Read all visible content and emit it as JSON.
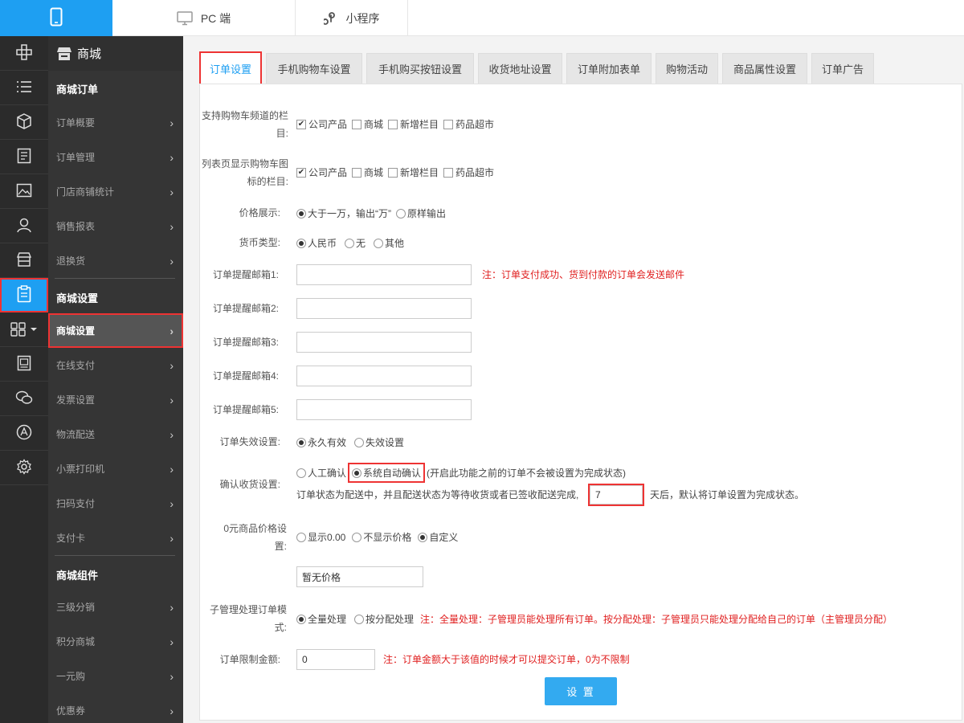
{
  "topbar": {
    "tabs": [
      {
        "label": "PC 端",
        "icon": "monitor-icon"
      },
      {
        "label": "小程序",
        "icon": "mini-program-icon"
      }
    ]
  },
  "sidebar": {
    "title": "商城",
    "sections": [
      {
        "title": "商城订单",
        "items": [
          "订单概要",
          "订单管理",
          "门店商铺统计",
          "销售报表",
          "退换货"
        ]
      },
      {
        "title": "商城设置",
        "items": [
          "商城设置",
          "在线支付",
          "发票设置",
          "物流配送",
          "小票打印机",
          "扫码支付",
          "支付卡"
        ]
      },
      {
        "title": "商城组件",
        "items": [
          "三级分销",
          "积分商城",
          "一元购",
          "优惠券"
        ]
      }
    ],
    "active_item": "商城设置"
  },
  "tabs": [
    "订单设置",
    "手机购物车设置",
    "手机购买按钮设置",
    "收货地址设置",
    "订单附加表单",
    "购物活动",
    "商品属性设置",
    "订单广告"
  ],
  "form": {
    "cart_channel": {
      "label": "支持购物车频道的栏目:",
      "options": [
        {
          "label": "公司产品",
          "checked": true
        },
        {
          "label": "商城",
          "checked": false
        },
        {
          "label": "新增栏目",
          "checked": false
        },
        {
          "label": "药品超市",
          "checked": false
        }
      ]
    },
    "list_cart_icon": {
      "label": "列表页显示购物车图标的栏目:",
      "options": [
        {
          "label": "公司产品",
          "checked": true
        },
        {
          "label": "商城",
          "checked": false
        },
        {
          "label": "新增栏目",
          "checked": false
        },
        {
          "label": "药品超市",
          "checked": false
        }
      ]
    },
    "price_display": {
      "label": "价格展示:",
      "options": [
        {
          "label": "大于一万，输出“万”",
          "checked": true
        },
        {
          "label": "原样输出",
          "checked": false
        }
      ]
    },
    "currency": {
      "label": "货币类型:",
      "options": [
        {
          "label": "人民币",
          "checked": true
        },
        {
          "label": "无",
          "checked": false
        },
        {
          "label": "其他",
          "checked": false
        }
      ]
    },
    "emails": [
      {
        "label": "订单提醒邮箱1:",
        "value": ""
      },
      {
        "label": "订单提醒邮箱2:",
        "value": ""
      },
      {
        "label": "订单提醒邮箱3:",
        "value": ""
      },
      {
        "label": "订单提醒邮箱4:",
        "value": ""
      },
      {
        "label": "订单提醒邮箱5:",
        "value": ""
      }
    ],
    "email_note": "注：订单支付成功、货到付款的订单会发送邮件",
    "expire": {
      "label": "订单失效设置:",
      "options": [
        {
          "label": "永久有效",
          "checked": true
        },
        {
          "label": "失效设置",
          "checked": false
        }
      ]
    },
    "confirm": {
      "label": "确认收货设置:",
      "options": [
        {
          "label": "人工确认",
          "checked": false
        },
        {
          "label": "系统自动确认",
          "checked": true
        }
      ],
      "hint": "(开启此功能之前的订单不会被设置为完成状态)",
      "desc_prefix": "订单状态为配送中，并且配送状态为等待收货或者已签收配送完成,",
      "days": "7",
      "desc_suffix": "天后，默认将订单设置为完成状态。"
    },
    "zero_price": {
      "label": "0元商品价格设置:",
      "options": [
        {
          "label": "显示0.00",
          "checked": false
        },
        {
          "label": "不显示价格",
          "checked": false
        },
        {
          "label": "自定义",
          "checked": true
        }
      ],
      "custom_value": "暂无价格"
    },
    "sub_admin": {
      "label": "子管理处理订单模式:",
      "options": [
        {
          "label": "全量处理",
          "checked": true
        },
        {
          "label": "按分配处理",
          "checked": false
        }
      ],
      "note": "注：全量处理：子管理员能处理所有订单。按分配处理：子管理员只能处理分配给自己的订单（主管理员分配）"
    },
    "limit": {
      "label": "订单限制金额:",
      "value": "0",
      "note": "注：订单金额大于该值的时候才可以提交订单，0为不限制"
    },
    "submit_label": "设 置"
  }
}
